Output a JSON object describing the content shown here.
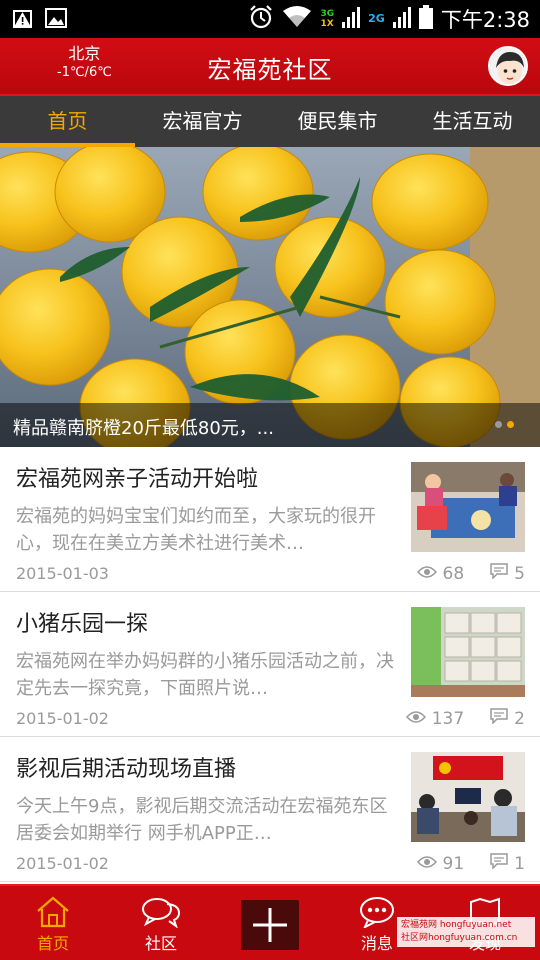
{
  "status_bar": {
    "network_top": "3G",
    "network_bottom": "1X",
    "network_alt": "2G",
    "time": "下午2:38",
    "icons": [
      "warning-icon",
      "image-icon",
      "alarm-icon",
      "wifi-icon",
      "signal-icon",
      "battery-icon"
    ]
  },
  "header": {
    "city": "北京",
    "temperature": "-1℃/6℃",
    "title": "宏福苑社区",
    "avatar_icon": "user-avatar-icon"
  },
  "tabs": [
    {
      "label": "首页",
      "active": true
    },
    {
      "label": "宏福官方",
      "active": false
    },
    {
      "label": "便民集市",
      "active": false
    },
    {
      "label": "生活互动",
      "active": false
    }
  ],
  "banner": {
    "caption": "精品赣南脐橙20斤最低80元，...",
    "dot_count": 2,
    "active_dot": 1
  },
  "news": [
    {
      "title": "宏福苑网亲子活动开始啦",
      "desc": "宏福苑的妈妈宝宝们如约而至，大家玩的很开心，现在在美立方美术社进行美术…",
      "date": "2015-01-03",
      "views": "68",
      "comments": "5"
    },
    {
      "title": "小猪乐园一探",
      "desc": "宏福苑网在举办妈妈群的小猪乐园活动之前，决定先去一探究竟，下面照片说…",
      "date": "2015-01-02",
      "views": "137",
      "comments": "2"
    },
    {
      "title": "影视后期活动现场直播",
      "desc": "今天上午9点，影视后期交流活动在宏福苑东区居委会如期举行 网手机APP正…",
      "date": "2015-01-02",
      "views": "91",
      "comments": "1"
    }
  ],
  "bottom_nav": {
    "home": "首页",
    "community": "社区",
    "messages": "消息",
    "discover": "发现"
  },
  "watermark": {
    "line1": "宏福苑网 hongfuyuan.net",
    "line2": "社区网hongfuyuan.com.cn"
  },
  "colors": {
    "brand_red": "#c80a10",
    "accent_orange": "#f6a800",
    "tab_bar": "#3a3a3a",
    "text_gray": "#9a9a9a"
  }
}
